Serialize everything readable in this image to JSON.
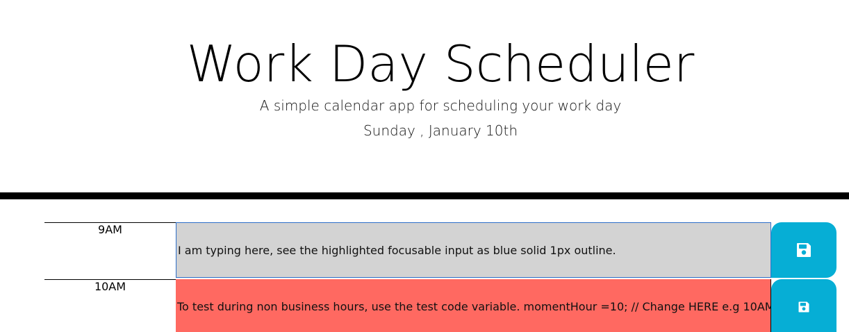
{
  "header": {
    "title": "Work Day Scheduler",
    "subtitle": "A simple calendar app for scheduling your work day",
    "current_day": "Sunday , January 10th"
  },
  "colors": {
    "past": "#d3d3d3",
    "present": "#ff6961",
    "save": "#06aed5",
    "focus_outline": "#2d6ec8"
  },
  "time_blocks": [
    {
      "hour": "9AM",
      "description": "I am typing here, see the highlighted focusable input as blue solid 1px outline.",
      "state": "past",
      "icon": "floppy-disk-icon"
    },
    {
      "hour": "10AM",
      "description": "To test during non business hours, use the test code variable. momentHour =10; // Change HERE e.g 10AM.",
      "state": "present",
      "icon": "floppy-disk-icon"
    }
  ]
}
